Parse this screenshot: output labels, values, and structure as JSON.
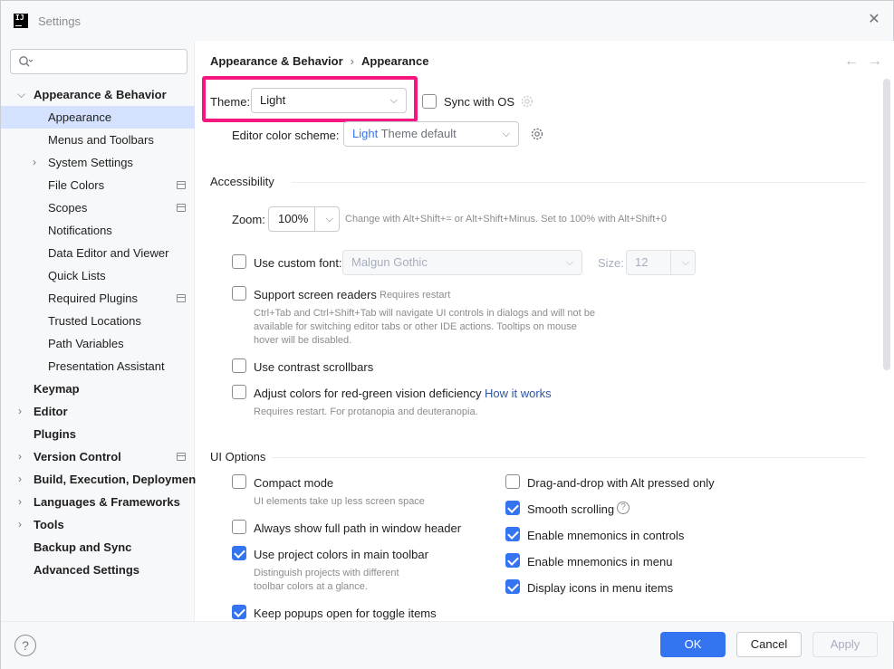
{
  "window": {
    "title": "Settings",
    "logo": "JetBrains-logo"
  },
  "search": {
    "placeholder": ""
  },
  "sidebar": {
    "items": [
      {
        "label": "Appearance & Behavior",
        "expanded": true
      },
      {
        "label": "Appearance"
      },
      {
        "label": "Menus and Toolbars"
      },
      {
        "label": "System Settings"
      },
      {
        "label": "File Colors"
      },
      {
        "label": "Scopes"
      },
      {
        "label": "Notifications"
      },
      {
        "label": "Data Editor and Viewer"
      },
      {
        "label": "Quick Lists"
      },
      {
        "label": "Required Plugins"
      },
      {
        "label": "Trusted Locations"
      },
      {
        "label": "Path Variables"
      },
      {
        "label": "Presentation Assistant"
      },
      {
        "label": "Keymap"
      },
      {
        "label": "Editor"
      },
      {
        "label": "Plugins"
      },
      {
        "label": "Version Control"
      },
      {
        "label": "Build, Execution, Deployment"
      },
      {
        "label": "Languages & Frameworks"
      },
      {
        "label": "Tools"
      },
      {
        "label": "Backup and Sync"
      },
      {
        "label": "Advanced Settings"
      }
    ],
    "selected": "Appearance"
  },
  "breadcrumb": {
    "parent": "Appearance & Behavior",
    "current": "Appearance"
  },
  "theme": {
    "label": "Theme:",
    "value": "Light",
    "sync_label": "Sync with OS",
    "sync_checked": false
  },
  "scheme": {
    "label": "Editor color scheme:",
    "value_prefix": "Light",
    "value": "Theme default"
  },
  "accessibility": {
    "title": "Accessibility",
    "zoom_label": "Zoom:",
    "zoom_value": "100%",
    "zoom_hint": "Change with Alt+Shift+= or Alt+Shift+Minus. Set to 100% with Alt+Shift+0",
    "custom_font_label": "Use custom font:",
    "custom_font_value": "Malgun Gothic",
    "custom_font_checked": false,
    "size_label": "Size:",
    "size_value": "12",
    "screen_readers_label": "Support screen readers",
    "screen_readers_hint": "Requires restart",
    "screen_readers_checked": false,
    "screen_readers_desc_1": "Ctrl+Tab and Ctrl+Shift+Tab will navigate UI controls in dialogs and will not be",
    "screen_readers_desc_2": "available for switching editor tabs or other IDE actions. Tooltips on mouse",
    "screen_readers_desc_3": "hover will be disabled.",
    "contrast_label": "Use contrast scrollbars",
    "contrast_checked": false,
    "color_def_label": "Adjust colors for red-green vision deficiency",
    "color_def_link": "How it works",
    "color_def_checked": false,
    "color_def_hint": "Requires restart. For protanopia and deuteranopia."
  },
  "ui_options": {
    "title": "UI Options",
    "compact_label": "Compact mode",
    "compact_hint": "UI elements take up less screen space",
    "compact_checked": false,
    "fullpath_label": "Always show full path in window header",
    "fullpath_checked": false,
    "projcolors_label": "Use project colors in main toolbar",
    "projcolors_checked": true,
    "projcolors_hint_1": "Distinguish projects with different",
    "projcolors_hint_2": "toolbar colors at a glance.",
    "popups_label": "Keep popups open for toggle items",
    "popups_checked": true,
    "dnd_label": "Drag-and-drop with Alt pressed only",
    "dnd_checked": false,
    "smooth_label": "Smooth scrolling",
    "smooth_checked": true,
    "mnem_controls_label": "Enable mnemonics in controls",
    "mnem_controls_checked": true,
    "mnem_menu_label": "Enable mnemonics in menu",
    "mnem_menu_checked": true,
    "icons_menu_label": "Display icons in menu items",
    "icons_menu_checked": true
  },
  "footer": {
    "help": "?",
    "ok": "OK",
    "cancel": "Cancel",
    "apply": "Apply"
  },
  "colors": {
    "accent": "#3574f0",
    "highlight": "#f5177f",
    "selection": "#d4e2ff",
    "link": "#2e55a3"
  }
}
